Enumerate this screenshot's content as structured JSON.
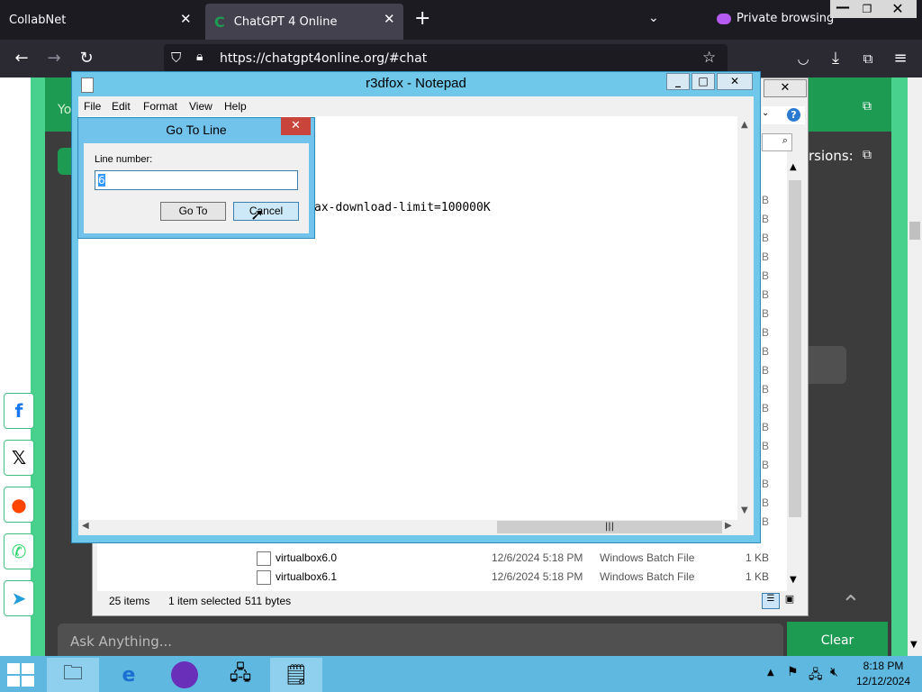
{
  "browser": {
    "tabs": [
      {
        "title": "CollabNet"
      },
      {
        "title": "ChatGPT 4 Online"
      }
    ],
    "new_tab": "+",
    "private_label": "Private browsing",
    "url": "https://chatgpt4online.org/#chat"
  },
  "website": {
    "header_text_fragment": "Yo",
    "versions_text": "rsions:",
    "ask_placeholder": "Ask Anything...",
    "clear_button": "Clear"
  },
  "explorer": {
    "files": [
      {
        "name": "virtualbox6.0",
        "date": "12/6/2024 5:18 PM",
        "type": "Windows Batch File",
        "size": "1 KB"
      },
      {
        "name": "virtualbox6.1",
        "date": "12/6/2024 5:18 PM",
        "type": "Windows Batch File",
        "size": "1 KB"
      }
    ],
    "status_items": "25 items",
    "status_selected": "1 item selected",
    "status_size": "511 bytes",
    "size_column_letter": "B"
  },
  "notepad": {
    "title": "r3dfox - Notepad",
    "menu": [
      "File",
      "Edit",
      "Format",
      "View",
      "Help"
    ],
    "visible_text": "ax-download-limit=100000K"
  },
  "goto_dialog": {
    "title": "Go To Line",
    "label": "Line number:",
    "value": "6",
    "goto_button": "Go To",
    "cancel_button": "Cancel"
  },
  "taskbar": {
    "time": "8:18 PM",
    "date": "12/12/2024"
  },
  "colors": {
    "site_green": "#47d18c",
    "taskbar": "#5fb8e0",
    "window_frame": "#6fc7ea"
  }
}
